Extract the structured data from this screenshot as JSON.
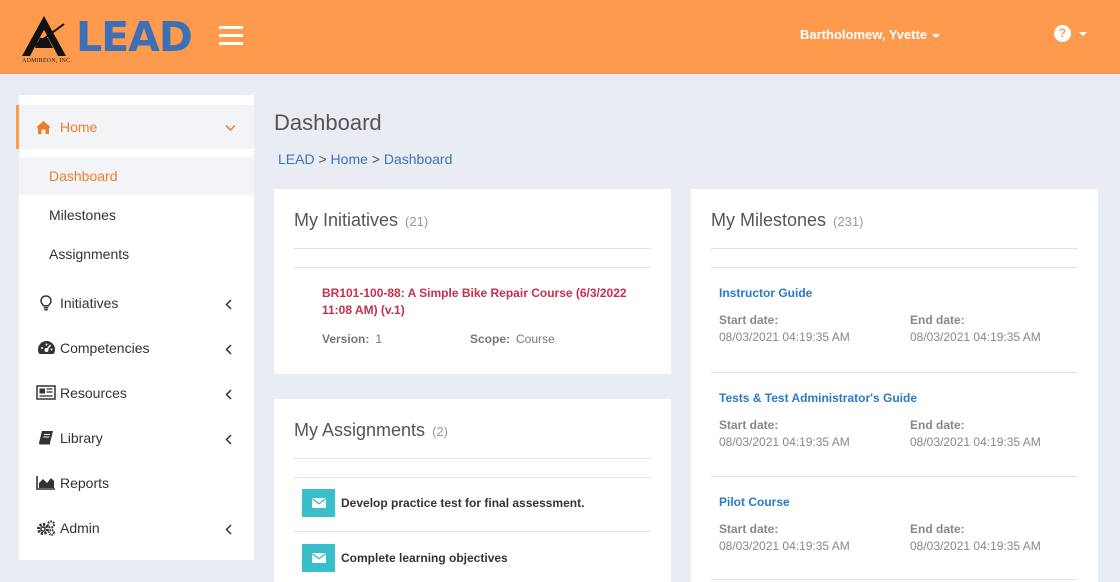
{
  "header": {
    "logo_text": "LEAD",
    "logo_subtext": "ADMIREON, INC.",
    "user_name": "Bartholomew, Yvette",
    "help_label": "?"
  },
  "colors": {
    "header_bg": "#fe9a4d",
    "accent": "#f07b2b",
    "link": "#3b74b8",
    "initiative_link": "#c4304d",
    "milestone_link": "#2a7bc7",
    "assignment_icon_bg": "#38bfc9"
  },
  "sidebar": {
    "home": {
      "label": "Home",
      "icon": "home-icon"
    },
    "home_children": [
      {
        "label": "Dashboard"
      },
      {
        "label": "Milestones"
      },
      {
        "label": "Assignments"
      }
    ],
    "items": [
      {
        "label": "Initiatives",
        "icon": "lightbulb-icon"
      },
      {
        "label": "Competencies",
        "icon": "dashboard-gauge-icon"
      },
      {
        "label": "Resources",
        "icon": "newspaper-icon"
      },
      {
        "label": "Library",
        "icon": "book-icon"
      },
      {
        "label": "Reports",
        "icon": "area-chart-icon"
      },
      {
        "label": "Admin",
        "icon": "gears-icon"
      }
    ]
  },
  "main": {
    "title": "Dashboard",
    "breadcrumb": {
      "root": "LEAD",
      "sep1": " > ",
      "mid": "Home",
      "sep2": " > ",
      "current": "Dashboard"
    }
  },
  "initiatives": {
    "title": "My Initiatives",
    "count": "(21)",
    "items": [
      {
        "title": "BR101-100-88: A Simple Bike Repair Course (6/3/2022 11:08 AM) (v.1)",
        "version_label": "Version:",
        "version": "1",
        "scope_label": "Scope:",
        "scope": "Course"
      }
    ]
  },
  "assignments": {
    "title": "My Assignments",
    "count": "(2)",
    "items": [
      {
        "text": "Develop practice test for final assessment."
      },
      {
        "text": "Complete learning objectives"
      }
    ]
  },
  "milestones": {
    "title": "My Milestones",
    "count": "(231)",
    "start_label": "Start date:",
    "end_label": "End date:",
    "items": [
      {
        "title": "Instructor Guide",
        "start": "08/03/2021 04:19:35 AM",
        "end": "08/03/2021 04:19:35 AM"
      },
      {
        "title": "Tests & Test Administrator's Guide",
        "start": "08/03/2021 04:19:35 AM",
        "end": "08/03/2021 04:19:35 AM"
      },
      {
        "title": "Pilot Course",
        "start": "08/03/2021 04:19:35 AM",
        "end": "08/03/2021 04:19:35 AM"
      }
    ]
  }
}
